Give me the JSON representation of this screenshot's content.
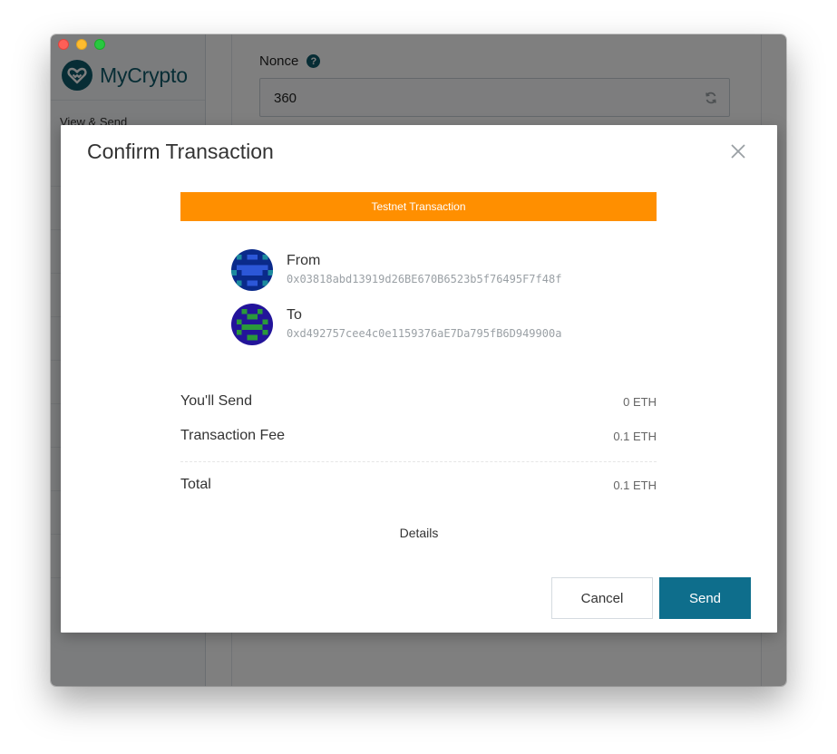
{
  "app": {
    "name": "MyCrypto",
    "sidebar": {
      "first_item": "View & Send"
    }
  },
  "nonce": {
    "label": "Nonce",
    "help_icon": "question-circle-icon",
    "value": "360",
    "refresh_icon": "refresh-icon"
  },
  "modal": {
    "title": "Confirm Transaction",
    "close_icon": "close-icon",
    "banner": "Testnet Transaction",
    "from": {
      "label": "From",
      "address": "0x03818abd13919d26BE670B6523b5f76495F7f48f"
    },
    "to": {
      "label": "To",
      "address": "0xd492757cee4c0e1159376aE7Da795fB6D949900a"
    },
    "summary": {
      "send_label": "You'll Send",
      "send_value": "0 ETH",
      "fee_label": "Transaction Fee",
      "fee_value": "0.1 ETH",
      "total_label": "Total",
      "total_value": "0.1 ETH"
    },
    "details_label": "Details",
    "cancel_label": "Cancel",
    "send_label": "Send"
  },
  "colors": {
    "brand": "#0e5a6b",
    "banner": "#ff8f00",
    "send_button": "#0e6e8c"
  }
}
